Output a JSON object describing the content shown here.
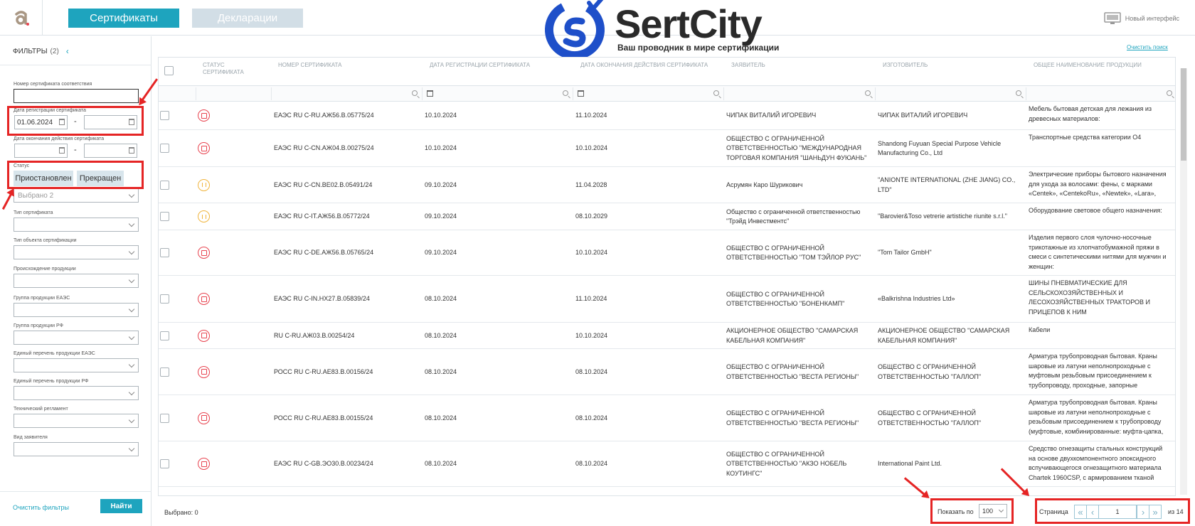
{
  "topbar": {
    "tabs": [
      {
        "label": "Сертификаты",
        "active": true
      },
      {
        "label": "Декларации",
        "active": false
      }
    ],
    "brand": {
      "name": "SertCity",
      "tagline": "Ваш проводник в мире сертификации"
    },
    "new_interface_label": "Новый интерфейс"
  },
  "sidebar": {
    "filters_title": "ФИЛЬТРЫ",
    "filters_count": "(2)",
    "fields": {
      "cert_number": {
        "label": "Номер сертификата соответствия",
        "value": ""
      },
      "reg_date": {
        "label": "Дата регистрации сертификата",
        "from": "01.06.2024",
        "to": ""
      },
      "end_date": {
        "label": "Дата окончания действия сертификата",
        "from": "",
        "to": ""
      },
      "status": {
        "label": "Статус",
        "chips": [
          "Приостановлен",
          "Прекращен"
        ],
        "placeholder": "Выбрано 2"
      }
    },
    "selects": [
      {
        "label": "Тип сертификата",
        "value": ""
      },
      {
        "label": "Тип объекта сертификации",
        "value": ""
      },
      {
        "label": "Происхождение продукции",
        "value": ""
      },
      {
        "label": "Группа продукции ЕАЭС",
        "value": ""
      },
      {
        "label": "Группа продукции РФ",
        "value": ""
      },
      {
        "label": "Единый перечень продукции ЕАЭС",
        "value": ""
      },
      {
        "label": "Единый перечень продукции РФ",
        "value": ""
      },
      {
        "label": "Технический регламент",
        "value": ""
      },
      {
        "label": "Вид заявителя",
        "value": ""
      }
    ],
    "clear_filters": "Очистить фильтры",
    "find_button": "Найти"
  },
  "main": {
    "clear_search": "Очистить поиск",
    "columns": [
      "СТАТУС СЕРТИФИКАТА",
      "НОМЕР СЕРТИФИКАТА",
      "ДАТА РЕГИСТРАЦИИ СЕРТИФИКАТА",
      "ДАТА ОКОНЧАНИЯ ДЕЙСТВИЯ СЕРТИФИКАТА",
      "ЗАЯВИТЕЛЬ",
      "ИЗГОТОВИТЕЛЬ",
      "ОБЩЕЕ НАИМЕНОВАНИЕ ПРОДУКЦИИ"
    ],
    "rows": [
      {
        "status": "stop",
        "number": "ЕАЭС RU C-RU.АЖ56.В.05775/24",
        "reg": "10.10.2024",
        "end": "11.10.2024",
        "applicant": "ЧИПАК ВИТАЛИЙ ИГОРЕВИЧ",
        "manufacturer": "ЧИПАК ВИТАЛИЙ ИГОРЕВИЧ",
        "product": "Мебель бытовая детская для лежания из древесных материалов:"
      },
      {
        "status": "stop",
        "number": "ЕАЭС RU C-CN.АЖ04.В.00275/24",
        "reg": "10.10.2024",
        "end": "10.10.2024",
        "applicant": "ОБЩЕСТВО С ОГРАНИЧЕННОЙ ОТВЕТСТВЕННОСТЬЮ \"МЕЖДУНАРОДНАЯ ТОРГОВАЯ КОМПАНИЯ \"ШАНЬДУН ФУЮАНЬ\"",
        "manufacturer": "Shandong Fuyuan Special Purpose Vehicle Manufacturing Co., Ltd",
        "product": "Транспортные средства категории О4"
      },
      {
        "status": "pause",
        "number": "ЕАЭС RU C-CN.ВЕ02.В.05491/24",
        "reg": "09.10.2024",
        "end": "11.04.2028",
        "applicant": "Асрумян Каро Шурикович",
        "manufacturer": "\"ANIONTE INTERNATIONAL (ZHE JIANG) CO., LTD\"",
        "product": "Электрические приборы бытового назначения для ухода за волосами: фены, с марками «Centek», «CentekoRu», «Newtek», «Lara»,"
      },
      {
        "status": "pause",
        "number": "ЕАЭС RU C-IT.АЖ56.В.05772/24",
        "reg": "09.10.2024",
        "end": "08.10.2029",
        "applicant": "Общество с ограниченной ответственностью \"Трэйд Инвестментс\"",
        "manufacturer": "\"Barovier&Toso vetrerie artistiche riunite s.r.l.\"",
        "product": "Оборудование световое общего назначения:"
      },
      {
        "status": "stop",
        "number": "ЕАЭС RU C-DE.АЖ56.В.05765/24",
        "reg": "09.10.2024",
        "end": "10.10.2024",
        "applicant": "ОБЩЕСТВО С ОГРАНИЧЕННОЙ ОТВЕТСТВЕННОСТЬЮ \"ТОМ ТЭЙЛОР РУС\"",
        "manufacturer": "\"Tom Tailor GmbH\"",
        "product": "Изделия первого слоя чулочно-носочные трикотажные из хлопчатобумажной пряжи в смеси с синтетическими нитями для мужчин и женщин:"
      },
      {
        "status": "stop",
        "number": "ЕАЭС RU C-IN.НХ27.В.05839/24",
        "reg": "08.10.2024",
        "end": "11.10.2024",
        "applicant": "ОБЩЕСТВО С ОГРАНИЧЕННОЙ ОТВЕТСТВЕННОСТЬЮ \"БОНЕНКАМП\"",
        "manufacturer": "«Balkrishna Industries Ltd»",
        "product": "ШИНЫ ПНЕВМАТИЧЕСКИЕ ДЛЯ СЕЛЬСКОХОЗЯЙСТВЕННЫХ И ЛЕСОХОЗЯЙСТВЕННЫХ ТРАКТОРОВ И ПРИЦЕПОВ К НИМ"
      },
      {
        "status": "stop",
        "number": "RU C-RU.АЖ03.В.00254/24",
        "reg": "08.10.2024",
        "end": "10.10.2024",
        "applicant": "АКЦИОНЕРНОЕ ОБЩЕСТВО \"САМАРСКАЯ КАБЕЛЬНАЯ КОМПАНИЯ\"",
        "manufacturer": "АКЦИОНЕРНОЕ ОБЩЕСТВО \"САМАРСКАЯ КАБЕЛЬНАЯ КОМПАНИЯ\"",
        "product": "Кабели"
      },
      {
        "status": "stop",
        "number": "РОСС RU C-RU.АЕ83.В.00156/24",
        "reg": "08.10.2024",
        "end": "08.10.2024",
        "applicant": "ОБЩЕСТВО С ОГРАНИЧЕННОЙ ОТВЕТСТВЕННОСТЬЮ \"ВЕСТА РЕГИОНЫ\"",
        "manufacturer": "ОБЩЕСТВО С ОГРАНИЧЕННОЙ ОТВЕТСТВЕННОСТЬЮ \"ГАЛЛОП\"",
        "product": "Арматура трубопроводная бытовая. Краны шаровые из латуни неполнопроходные с муфтовым резьбовым присоединением к трубопроводу, проходные, запорные"
      },
      {
        "status": "stop",
        "number": "РОСС RU C-RU.АЕ83.В.00155/24",
        "reg": "08.10.2024",
        "end": "08.10.2024",
        "applicant": "ОБЩЕСТВО С ОГРАНИЧЕННОЙ ОТВЕТСТВЕННОСТЬЮ \"ВЕСТА РЕГИОНЫ\"",
        "manufacturer": "ОБЩЕСТВО С ОГРАНИЧЕННОЙ ОТВЕТСТВЕННОСТЬЮ \"ГАЛЛОП\"",
        "product": "Арматура трубопроводная бытовая. Краны шаровые из латуни неполнопроходные с резьбовым присоединением к трубопроводу (муфтовые, комбинированные: муфта-цапка,"
      },
      {
        "status": "stop",
        "number": "ЕАЭС RU C-GB.ЭО30.В.00234/24",
        "reg": "08.10.2024",
        "end": "08.10.2024",
        "applicant": "ОБЩЕСТВО С ОГРАНИЧЕННОЙ ОТВЕТСТВЕННОСТЬЮ \"АКЗО НОБЕЛЬ КОУТИНГС\"",
        "manufacturer": "International Paint Ltd.",
        "product": "Средство огнезащиты стальных конструкций на основе двухкомпонентного эпоксидного вспучивающегося огнезащитного материала Chartek 1960CSP, с армированием тканой сеткой"
      }
    ]
  },
  "footer": {
    "selected": "Выбрано: 0",
    "page_size_label": "Показать по",
    "page_size": "100",
    "page_label": "Страница",
    "page": "1",
    "total": "из 14"
  }
}
